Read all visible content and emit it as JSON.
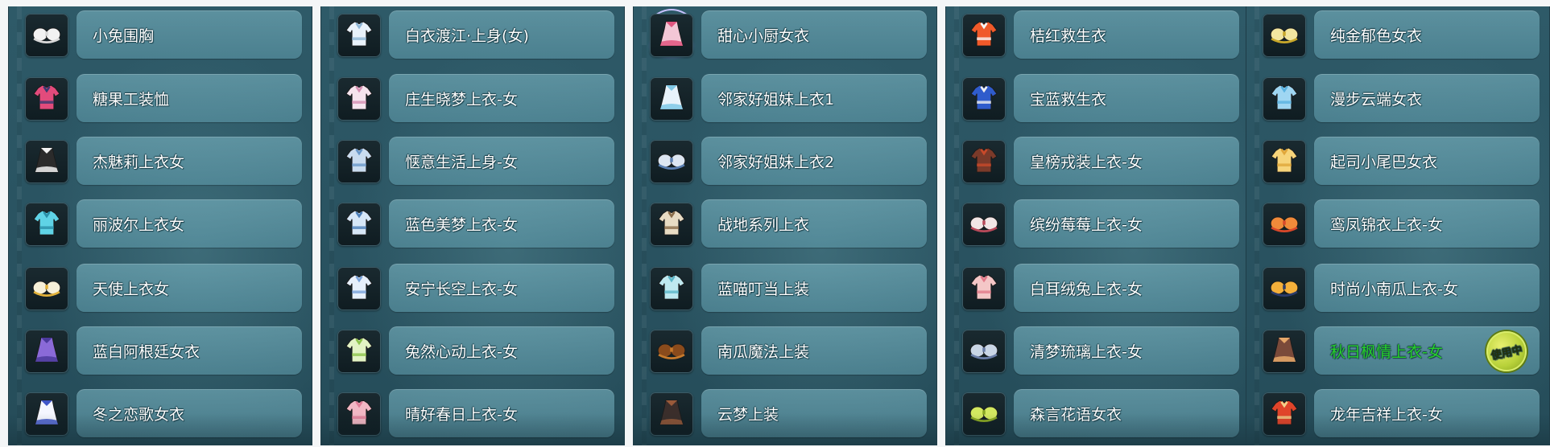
{
  "columns": [
    {
      "items": [
        {
          "name": "小兔围胸",
          "icon": "white-bra-icon"
        },
        {
          "name": "糖果工装恤",
          "icon": "pink-shirt-icon"
        },
        {
          "name": "杰魅莉上衣女",
          "icon": "black-white-top-icon"
        },
        {
          "name": "丽波尔上衣女",
          "icon": "cyan-top-icon"
        },
        {
          "name": "天使上衣女",
          "icon": "angel-top-icon"
        },
        {
          "name": "蓝白阿根廷女衣",
          "icon": "purple-dress-icon"
        },
        {
          "name": "冬之恋歌女衣",
          "icon": "winter-dress-icon"
        }
      ]
    },
    {
      "items": [
        {
          "name": "白衣渡江·上身(女)",
          "icon": "white-robe-icon"
        },
        {
          "name": "庄生晓梦上衣-女",
          "icon": "pink-white-top-icon"
        },
        {
          "name": "惬意生活上身-女",
          "icon": "blue-casual-top-icon"
        },
        {
          "name": "蓝色美梦上衣-女",
          "icon": "blue-dream-top-icon"
        },
        {
          "name": "安宁长空上衣-女",
          "icon": "checkered-top-icon"
        },
        {
          "name": "兔然心动上衣-女",
          "icon": "green-tshirt-icon"
        },
        {
          "name": "晴好春日上衣-女",
          "icon": "pink-spring-top-icon"
        }
      ]
    },
    {
      "items": [
        {
          "name": "甜心小厨女衣",
          "icon": "chef-dress-icon",
          "highlight": true
        },
        {
          "name": "邻家好姐妹上衣1",
          "icon": "sister-top-1-icon"
        },
        {
          "name": "邻家好姐妹上衣2",
          "icon": "sister-top-2-icon"
        },
        {
          "name": "战地系列上衣",
          "icon": "camo-top-icon"
        },
        {
          "name": "蓝喵叮当上装",
          "icon": "blue-cat-top-icon"
        },
        {
          "name": "南瓜魔法上装",
          "icon": "pumpkin-top-icon"
        },
        {
          "name": "云梦上装",
          "icon": "dark-armor-icon"
        }
      ]
    },
    {
      "items": [
        {
          "name": "桔红救生衣",
          "icon": "orange-lifevest-icon"
        },
        {
          "name": "宝蓝救生衣",
          "icon": "blue-lifevest-icon"
        },
        {
          "name": "皇榜戎装上衣-女",
          "icon": "red-armor-icon"
        },
        {
          "name": "缤纷莓莓上衣-女",
          "icon": "berry-top-icon"
        },
        {
          "name": "白耳绒兔上衣-女",
          "icon": "bunny-top-icon"
        },
        {
          "name": "清梦琉璃上衣-女",
          "icon": "glass-top-icon"
        },
        {
          "name": "森言花语女衣",
          "icon": "flower-dress-icon"
        }
      ]
    },
    {
      "items": [
        {
          "name": "纯金郁色女衣",
          "icon": "gold-dress-icon"
        },
        {
          "name": "漫步云端女衣",
          "icon": "cloud-dress-icon"
        },
        {
          "name": "起司小尾巴女衣",
          "icon": "cheese-dress-icon"
        },
        {
          "name": "鸾凤锦衣上衣-女",
          "icon": "phoenix-top-icon"
        },
        {
          "name": "时尚小南瓜上衣-女",
          "icon": "pumpkin-fashion-icon"
        },
        {
          "name": "秋日枫情上衣-女",
          "icon": "autumn-top-icon",
          "equipped": true,
          "badge": "使用中"
        },
        {
          "name": "龙年吉祥上衣-女",
          "icon": "dragon-year-top-icon"
        }
      ]
    }
  ],
  "colors": {
    "panel_bg": "#2a5462",
    "label_bg": "#6ca8b8",
    "label_text": "#ffffff",
    "equipped_text": "#26d12b",
    "badge_bg": "#b9d23a"
  }
}
